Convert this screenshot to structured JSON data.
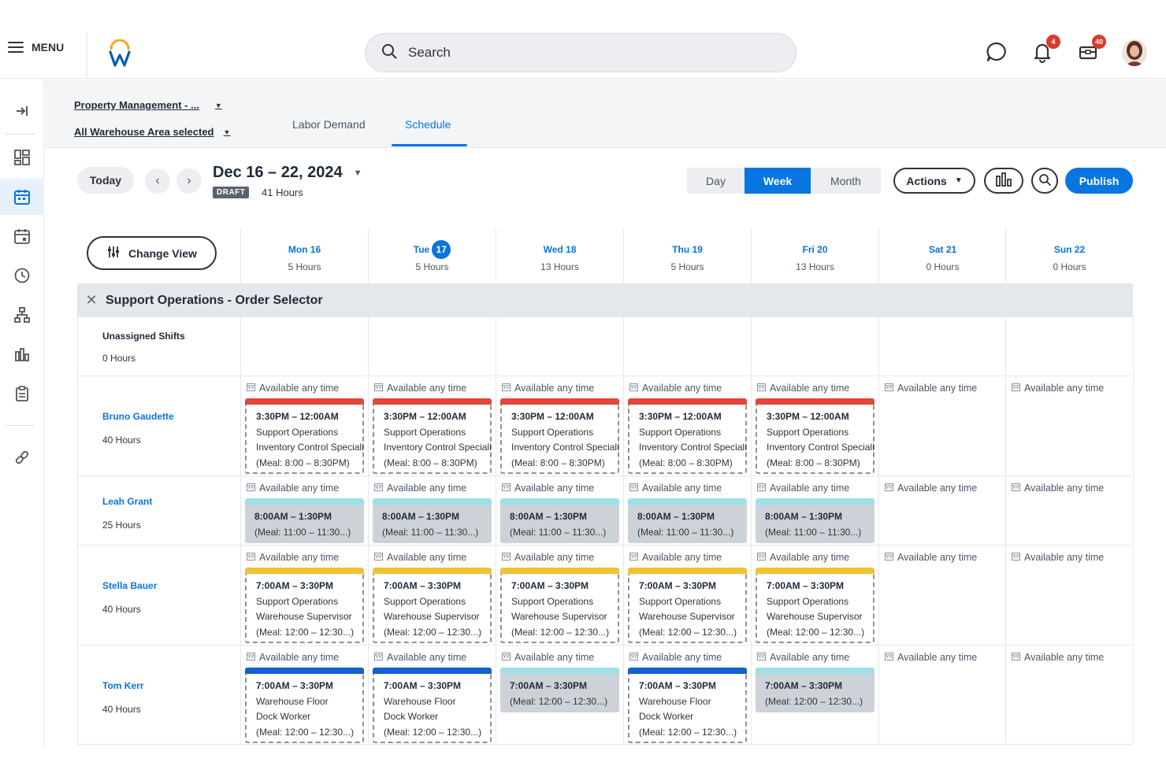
{
  "topbar": {
    "menu_label": "MENU",
    "search_placeholder": "Search",
    "notifications_count": "4",
    "inbox_count": "40"
  },
  "filters": {
    "org": "Property Management - ...",
    "area": "All Warehouse Area selected"
  },
  "tabs": [
    {
      "label": "Labor Demand",
      "active": false
    },
    {
      "label": "Schedule",
      "active": true
    }
  ],
  "toolbar": {
    "today_label": "Today",
    "date_range": "Dec 16 – 22, 2024",
    "status": "DRAFT",
    "total_hours": "41 Hours",
    "views": [
      "Day",
      "Week",
      "Month"
    ],
    "active_view": "Week",
    "actions_label": "Actions",
    "publish_label": "Publish"
  },
  "grid": {
    "change_view_label": "Change View",
    "days": [
      {
        "name": "Mon 16",
        "hours": "5 Hours"
      },
      {
        "name": "Tue",
        "day_number": "17",
        "hours": "5 Hours",
        "today": true
      },
      {
        "name": "Wed 18",
        "hours": "13 Hours"
      },
      {
        "name": "Thu 19",
        "hours": "5 Hours"
      },
      {
        "name": "Fri 20",
        "hours": "13 Hours"
      },
      {
        "name": "Sat 21",
        "hours": "0 Hours"
      },
      {
        "name": "Sun 22",
        "hours": "0 Hours"
      }
    ],
    "group_title": "Support Operations - Order Selector",
    "unassigned": {
      "label": "Unassigned Shifts",
      "hours": "0 Hours"
    },
    "available_label": "Available any time",
    "employees": [
      {
        "name": "Bruno Gaudette",
        "hours": "40 Hours",
        "shifts": [
          {
            "style": "dashed",
            "bar": "#e5463b",
            "lines": [
              "3:30PM – 12:00AM",
              "Support Operations",
              "Inventory Control Specialist",
              "(Meal: 8:00 – 8:30PM)"
            ]
          },
          {
            "style": "dashed",
            "bar": "#e5463b",
            "lines": [
              "3:30PM – 12:00AM",
              "Support Operations",
              "Inventory Control Specialist",
              "(Meal: 8:00 – 8:30PM)"
            ]
          },
          {
            "style": "dashed",
            "bar": "#e5463b",
            "lines": [
              "3:30PM – 12:00AM",
              "Support Operations",
              "Inventory Control Specialist",
              "(Meal: 8:00 – 8:30PM)"
            ]
          },
          {
            "style": "dashed",
            "bar": "#e5463b",
            "lines": [
              "3:30PM – 12:00AM",
              "Support Operations",
              "Inventory Control Specialist",
              "(Meal: 8:00 – 8:30PM)"
            ]
          },
          {
            "style": "dashed",
            "bar": "#e5463b",
            "lines": [
              "3:30PM – 12:00AM",
              "Support Operations",
              "Inventory Control Specialist",
              "(Meal: 8:00 – 8:30PM)"
            ]
          },
          null,
          null
        ]
      },
      {
        "name": "Leah Grant",
        "hours": "25 Hours",
        "shifts": [
          {
            "style": "solid",
            "bar": "#9ee0e6",
            "lines": [
              "8:00AM – 1:30PM",
              "(Meal: 11:00 – 11:30...)"
            ]
          },
          {
            "style": "solid",
            "bar": "#9ee0e6",
            "lines": [
              "8:00AM – 1:30PM",
              "(Meal: 11:00 – 11:30...)"
            ]
          },
          {
            "style": "solid",
            "bar": "#9ee0e6",
            "lines": [
              "8:00AM – 1:30PM",
              "(Meal: 11:00 – 11:30...)"
            ]
          },
          {
            "style": "solid",
            "bar": "#9ee0e6",
            "lines": [
              "8:00AM – 1:30PM",
              "(Meal: 11:00 – 11:30...)"
            ]
          },
          {
            "style": "solid",
            "bar": "#9ee0e6",
            "lines": [
              "8:00AM – 1:30PM",
              "(Meal: 11:00 – 11:30...)"
            ]
          },
          null,
          null
        ]
      },
      {
        "name": "Stella Bauer",
        "hours": "40 Hours",
        "shifts": [
          {
            "style": "dashed",
            "bar": "#f2c233",
            "lines": [
              "7:00AM – 3:30PM",
              "Support Operations",
              "Warehouse Supervisor",
              "(Meal: 12:00 – 12:30...)"
            ]
          },
          {
            "style": "dashed",
            "bar": "#f2c233",
            "lines": [
              "7:00AM – 3:30PM",
              "Support Operations",
              "Warehouse Supervisor",
              "(Meal: 12:00 – 12:30...)"
            ]
          },
          {
            "style": "dashed",
            "bar": "#f2c233",
            "lines": [
              "7:00AM – 3:30PM",
              "Support Operations",
              "Warehouse Supervisor",
              "(Meal: 12:00 – 12:30...)"
            ]
          },
          {
            "style": "dashed",
            "bar": "#f2c233",
            "lines": [
              "7:00AM – 3:30PM",
              "Support Operations",
              "Warehouse Supervisor",
              "(Meal: 12:00 – 12:30...)"
            ]
          },
          {
            "style": "dashed",
            "bar": "#f2c233",
            "lines": [
              "7:00AM – 3:30PM",
              "Support Operations",
              "Warehouse Supervisor",
              "(Meal: 12:00 – 12:30...)"
            ]
          },
          null,
          null
        ]
      },
      {
        "name": "Tom Kerr",
        "hours": "40 Hours",
        "shifts": [
          {
            "style": "dashed",
            "bar": "#1160d4",
            "lines": [
              "7:00AM – 3:30PM",
              "Warehouse Floor",
              "Dock Worker",
              "(Meal: 12:00 – 12:30...)"
            ]
          },
          {
            "style": "dashed",
            "bar": "#1160d4",
            "lines": [
              "7:00AM – 3:30PM",
              "Warehouse Floor",
              "Dock Worker",
              "(Meal: 12:00 – 12:30...)"
            ]
          },
          {
            "style": "solid",
            "bar": "#9ee0e6",
            "lines": [
              "7:00AM – 3:30PM",
              "(Meal: 12:00 – 12:30...)"
            ]
          },
          {
            "style": "dashed",
            "bar": "#1160d4",
            "lines": [
              "7:00AM – 3:30PM",
              "Warehouse Floor",
              "Dock Worker",
              "(Meal: 12:00 – 12:30...)"
            ]
          },
          {
            "style": "solid",
            "bar": "#9ee0e6",
            "lines": [
              "7:00AM – 3:30PM",
              "(Meal: 12:00 – 12:30...)"
            ]
          },
          null,
          null
        ]
      }
    ]
  },
  "colors": {
    "accent": "#0875e1",
    "badge": "#d83a2a"
  }
}
